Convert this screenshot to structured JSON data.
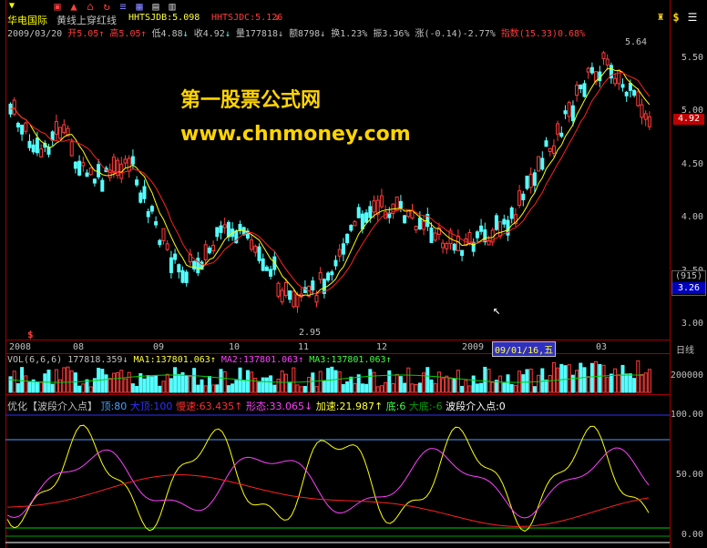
{
  "header": {
    "stock_name": "华电国际",
    "indicator_name": "黄线上穿红线",
    "hhtsjdb": "HHTSJDB:5.098",
    "hhtsjdc": "HHTSJDC:5.126",
    "arrow_down": "↓"
  },
  "quote": {
    "date": "2009/03/20",
    "open": "开5.05",
    "high": "高5.05",
    "low": "低4.88",
    "close": "收4.92",
    "volume": "量177818",
    "amount": "额8798",
    "turnover": "换1.23%",
    "amplitude": "振3.36%",
    "change": "涨(-0.14)-2.77%",
    "index": "指数(15.33)0.68%"
  },
  "watermark": {
    "title": "第一股票公式网",
    "url": "www.chnmoney.com"
  },
  "price_axis": {
    "ticks": [
      "5.50",
      "5.00",
      "4.50",
      "4.00",
      "3.50",
      "3.00"
    ],
    "current": "4.92",
    "info_box_top": "(915)",
    "info_box_bottom": "3.26",
    "high_marker": "5.64",
    "low_marker": "2.95",
    "signal_mark": "$"
  },
  "date_axis": {
    "labels": [
      "2008",
      "08",
      "09",
      "10",
      "11",
      "12",
      "2009",
      "03"
    ],
    "highlight": "09/01/16,五",
    "period": "日线"
  },
  "volume_panel": {
    "title": "VOL(6,6,6)",
    "vol": "177818.359",
    "ma1": "MA1:137801.063",
    "ma2": "MA2:137801.063",
    "ma3": "MA3:137801.063",
    "axis_label": "200000"
  },
  "indicator_panel": {
    "name": "优化【波段介入点】",
    "top": "顶:80",
    "big_top": "大顶:100",
    "slow": "慢速:63.435",
    "form": "形态:33.065",
    "fast": "加速:21.987",
    "bottom": "底:6",
    "big_bottom": "大底:-6",
    "entry": "波段介入点:0",
    "ticks": [
      "100.00",
      "50.00",
      "0.00"
    ]
  },
  "colors": {
    "up": "#ff3c3c",
    "down": "#54ffff",
    "yellow": "#ffff00",
    "red_line": "#ff2020",
    "magenta": "#ff40ff",
    "blue_line": "#4aa0ff",
    "green_line": "#00d000",
    "grid": "#a00000"
  },
  "toolbar_icons": [
    "trophy-icon",
    "lock-icon",
    "home-icon",
    "list-icon",
    "grid-icon",
    "chart-icon",
    "refresh-icon"
  ]
}
